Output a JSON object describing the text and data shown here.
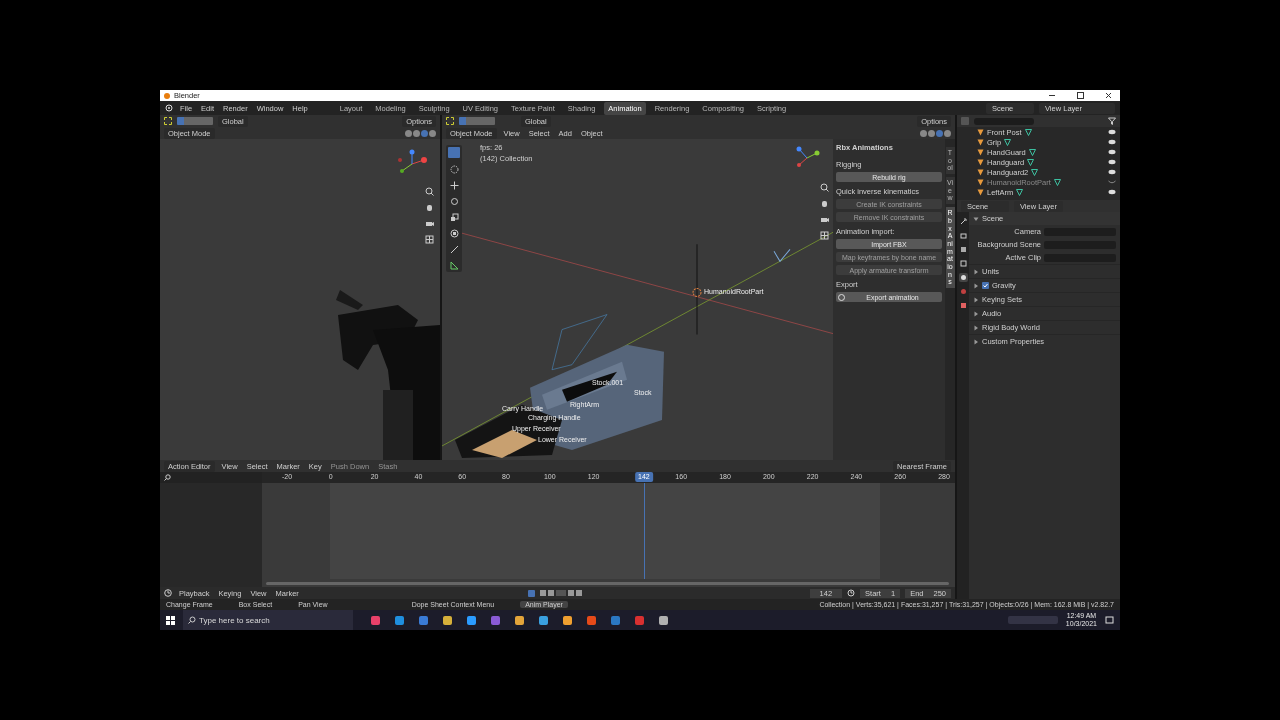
{
  "window": {
    "title": "Blender"
  },
  "menu": [
    "File",
    "Edit",
    "Render",
    "Window",
    "Help"
  ],
  "workspaces": [
    {
      "label": "Layout",
      "selected": false
    },
    {
      "label": "Modeling",
      "selected": false
    },
    {
      "label": "Sculpting",
      "selected": false
    },
    {
      "label": "UV Editing",
      "selected": false
    },
    {
      "label": "Texture Paint",
      "selected": false
    },
    {
      "label": "Shading",
      "selected": false
    },
    {
      "label": "Animation",
      "selected": true
    },
    {
      "label": "Rendering",
      "selected": false
    },
    {
      "label": "Compositing",
      "selected": false
    },
    {
      "label": "Scripting",
      "selected": false
    }
  ],
  "scene": "Scene",
  "view_layer": "View Layer",
  "left_viewport": {
    "transform": "Global",
    "options": "Options",
    "mode": "Object Mode"
  },
  "right_viewport": {
    "mode": "Object Mode",
    "menu": [
      "View",
      "Select",
      "Add",
      "Object"
    ],
    "transform": "Global",
    "options": "Options",
    "overlay": [
      "fps: 26",
      "(142) Collection"
    ],
    "labels": [
      {
        "text": "HumanoidRootPart",
        "kind": "origin"
      },
      {
        "text": "Stock.001",
        "kind": "bone"
      },
      {
        "text": "Stock",
        "kind": "bone"
      },
      {
        "text": "RightArm",
        "kind": "bone"
      },
      {
        "text": "Carry Handle",
        "kind": "bone"
      },
      {
        "text": "Charging Handle",
        "kind": "bone"
      },
      {
        "text": "Upper Receiver",
        "kind": "bone"
      },
      {
        "text": "Lower Receiver",
        "kind": "bone"
      }
    ]
  },
  "n_panel": {
    "tabs": [
      {
        "label": "Tool",
        "selected": false
      },
      {
        "label": "View",
        "selected": false
      },
      {
        "label": "Rbx Animations",
        "selected": true
      }
    ],
    "title": "Rbx Animations",
    "sections": [
      {
        "heading": "Rigging",
        "buttons": [
          {
            "label": "Rebuild rig",
            "disabled": false
          }
        ]
      },
      {
        "heading": "Quick inverse kinematics",
        "buttons": [
          {
            "label": "Create IK constraints",
            "disabled": true
          },
          {
            "label": "Remove IK constraints",
            "disabled": true
          }
        ]
      },
      {
        "heading": "Animation import:",
        "buttons": [
          {
            "label": "Import FBX",
            "disabled": false
          },
          {
            "label": "Map keyframes by bone name",
            "disabled": true
          },
          {
            "label": "Apply armature transform",
            "disabled": true
          }
        ]
      },
      {
        "heading": "Export",
        "buttons": [
          {
            "label": "Export animation",
            "disabled": false,
            "kind": "icon"
          }
        ]
      }
    ]
  },
  "outliner": {
    "items": [
      {
        "name": "Front Post",
        "visible": true
      },
      {
        "name": "Grip",
        "visible": true
      },
      {
        "name": "HandGuard",
        "visible": true
      },
      {
        "name": "Handguard",
        "visible": true
      },
      {
        "name": "Handguard2",
        "visible": true
      },
      {
        "name": "HumanoidRootPart",
        "visible": false
      },
      {
        "name": "LeftArm",
        "visible": true
      }
    ]
  },
  "properties": {
    "scene": "Scene",
    "view_layer": "View Layer",
    "tabs": [
      {
        "kind": "tool",
        "selected": false
      },
      {
        "kind": "render",
        "selected": false
      },
      {
        "kind": "output",
        "selected": false
      },
      {
        "kind": "view_layer",
        "selected": false
      },
      {
        "kind": "scene",
        "selected": true
      },
      {
        "kind": "world",
        "selected": false
      },
      {
        "kind": "object",
        "selected": false
      }
    ],
    "panel": "Scene",
    "expanded": true,
    "fields": [
      "Camera",
      "Background Scene",
      "Active Clip"
    ],
    "sections": [
      {
        "label": "Units",
        "kind": "plain"
      },
      {
        "label": "Gravity",
        "kind": "check",
        "checked": true
      },
      {
        "label": "Keying Sets",
        "kind": "plain"
      },
      {
        "label": "Audio",
        "kind": "plain"
      },
      {
        "label": "Rigid Body World",
        "kind": "plain"
      },
      {
        "label": "Custom Properties",
        "kind": "plain"
      }
    ]
  },
  "action_editor": {
    "mode": "Action Editor",
    "menu": [
      "View",
      "Select",
      "Marker",
      "Key"
    ],
    "push_down": "Push Down",
    "stash": "Stash",
    "snap": "Nearest Frame",
    "ruler_before": [
      "-20",
      "0",
      "20",
      "40",
      "60",
      "80",
      "100",
      "120"
    ],
    "ruler_after": [
      "160",
      "180",
      "200",
      "220",
      "240",
      "260",
      "280"
    ],
    "current_frame": "142",
    "level": 0.551
  },
  "timeline": {
    "menu": [
      "Playback",
      "Keying",
      "View",
      "Marker"
    ],
    "frame": "142",
    "start_label": "Start",
    "start": "1",
    "end_label": "End",
    "end": "250"
  },
  "status_bar": {
    "hints": [
      "Change Frame",
      "Box Select",
      "Pan View",
      "Dope Sheet Context Menu"
    ],
    "popup": "Anim Player",
    "stats": "Collection | Verts:35,621 | Faces:31,257 | Tris:31,257 | Objects:0/26 | Mem: 162.8 MiB | v2.82.7"
  },
  "taskbar": {
    "search_placeholder": "Type here to search",
    "time": "12:49 AM",
    "date": "10/3/2021"
  }
}
